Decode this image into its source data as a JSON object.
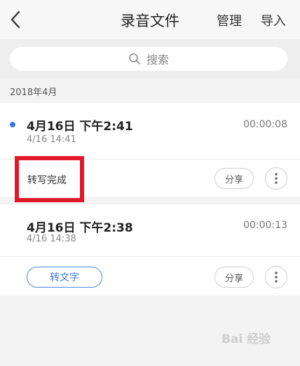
{
  "header": {
    "title": "录音文件",
    "manage_label": "管理",
    "import_label": "导入",
    "back_icon": "chevron-left-icon"
  },
  "search": {
    "placeholder": "搜索",
    "icon": "search-icon"
  },
  "section": {
    "label": "2018年4月"
  },
  "recordings": [
    {
      "name": "4月16日 下午2:41",
      "subtitle": "4/16  14:41",
      "duration": "00:00:08",
      "status_label": "转写完成",
      "share_label": "分享",
      "is_new": true
    },
    {
      "name": "4月16日 下午2:38",
      "subtitle": "4/16  14:38",
      "duration": "00:00:13",
      "convert_label": "转文字",
      "share_label": "分享",
      "is_new": false
    }
  ],
  "watermark": {
    "text": "Bai 经验"
  },
  "colors": {
    "accent": "#3a78e0",
    "highlight": "#e0192a",
    "background": "#f3f3f3"
  }
}
